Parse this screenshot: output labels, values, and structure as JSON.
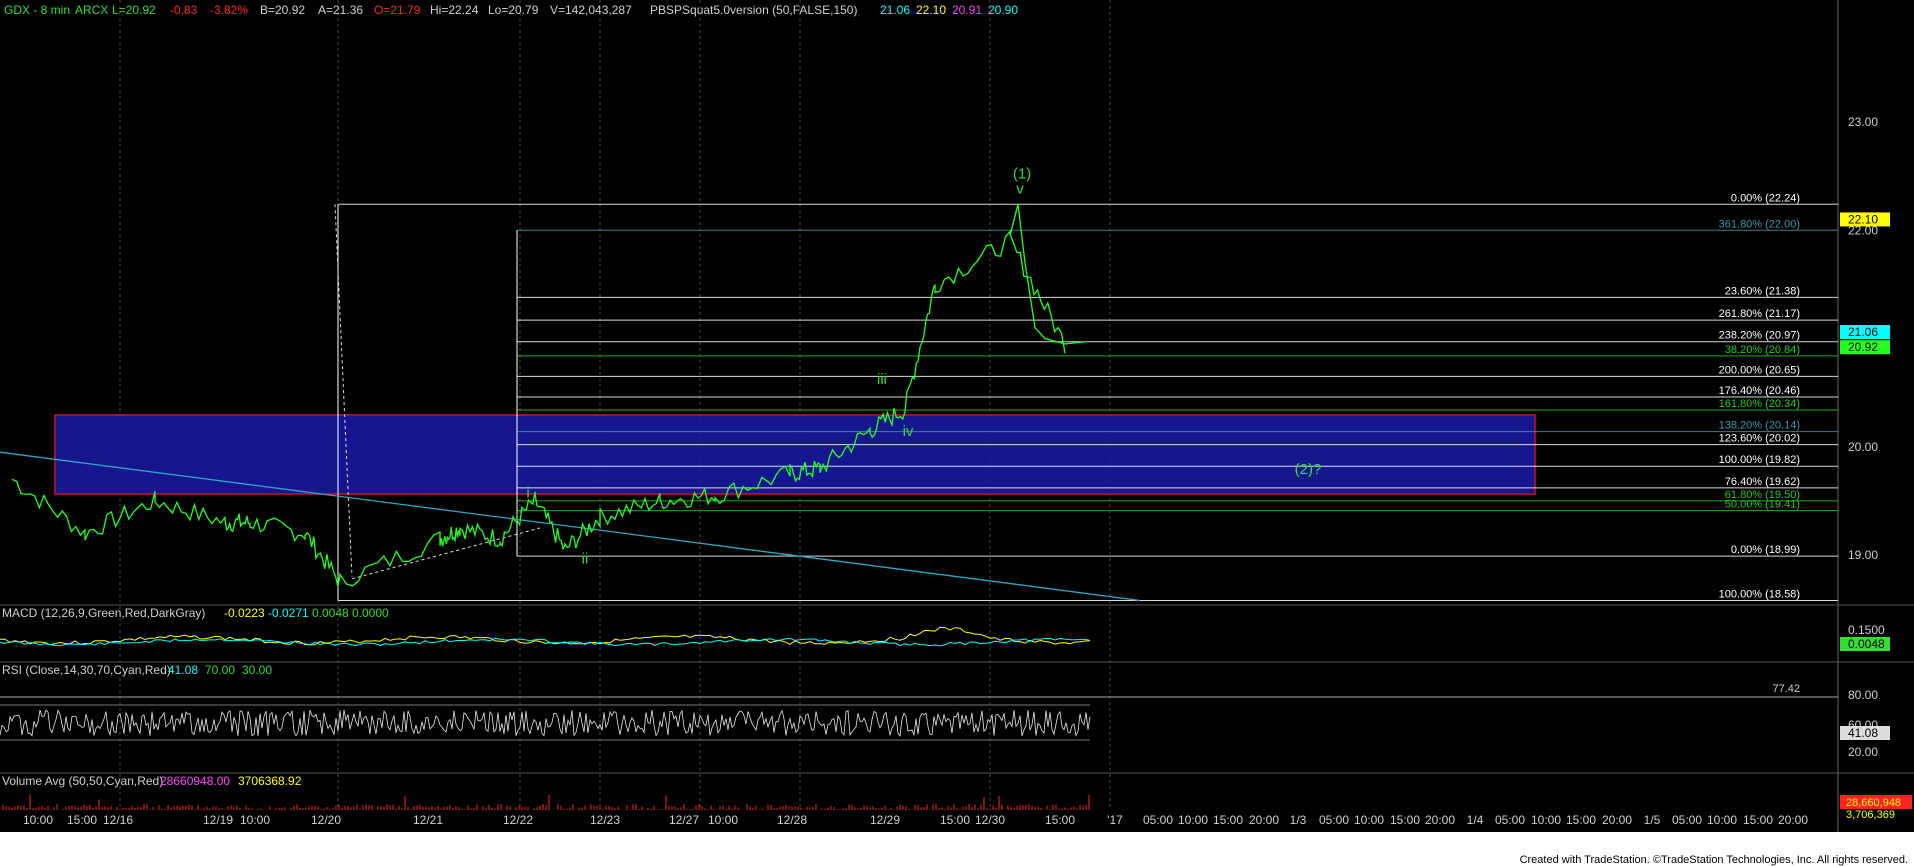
{
  "header": {
    "symbol": "GDX - 8 min",
    "exchange": "ARCX",
    "last": "L=20.92",
    "change": "-0.83",
    "pct": "-3.82%",
    "bid": "B=20.92",
    "ask": "A=21.36",
    "open": "O=21.79",
    "high": "Hi=22.24",
    "low": "Lo=20.79",
    "volume": "V=142,043,287",
    "indicator": "PBSPSquat5.0version (50,FALSE,150)",
    "ind_v1": "21.06",
    "ind_v2": "22.10",
    "ind_v3": "20.91",
    "ind_v4": "20.90"
  },
  "colors": {
    "price": "#22ff22",
    "fib_green": "#22cc22",
    "fib_white": "#ffffff",
    "fib_teal": "#3a9aa8",
    "box_fill": "#1a1aa8",
    "box_border": "#cc1133",
    "label_green": "#33dd33",
    "trend": "#2aa8c8",
    "cyan": "#00ffff",
    "yellow": "#ffff00",
    "magenta": "#ff44ff",
    "red": "#ff2222"
  },
  "price_axis": {
    "labels": [
      "23.00",
      "22.00",
      "20.00",
      "19.00"
    ],
    "tags": [
      {
        "text": "22.10",
        "bg": "#ffff00",
        "fg": "#000000"
      },
      {
        "text": "21.06",
        "bg": "#00ffff",
        "fg": "#000000"
      },
      {
        "text": "20.92",
        "bg": "#22ff22",
        "fg": "#000000"
      }
    ]
  },
  "fib_labels": [
    {
      "text": "0.00% (22.24)",
      "price": 22.24,
      "color": "white"
    },
    {
      "text": "361.80% (22.00)",
      "price": 22.0,
      "color": "teal"
    },
    {
      "text": "23.60% (21.38)",
      "price": 21.38,
      "color": "white"
    },
    {
      "text": "261.80% (21.17)",
      "price": 21.17,
      "color": "white"
    },
    {
      "text": "238.20% (20.97)",
      "price": 20.97,
      "color": "white"
    },
    {
      "text": "38.20% (20.84)",
      "price": 20.84,
      "color": "green"
    },
    {
      "text": "200.00% (20.65)",
      "price": 20.65,
      "color": "white"
    },
    {
      "text": "176.40% (20.46)",
      "price": 20.46,
      "color": "white"
    },
    {
      "text": "161.80% (20.34)",
      "price": 20.34,
      "color": "green"
    },
    {
      "text": "138.20% (20.14)",
      "price": 20.14,
      "color": "teal"
    },
    {
      "text": "123.60% (20.02)",
      "price": 20.02,
      "color": "white"
    },
    {
      "text": "100.00% (19.82)",
      "price": 19.82,
      "color": "white"
    },
    {
      "text": "76.40% (19.62)",
      "price": 19.62,
      "color": "white"
    },
    {
      "text": "61.80% (19.50)",
      "price": 19.5,
      "color": "green"
    },
    {
      "text": "50.00% (19.41)",
      "price": 19.41,
      "color": "green"
    },
    {
      "text": "0.00% (18.99)",
      "price": 18.99,
      "color": "white"
    },
    {
      "text": "100.00% (18.58)",
      "price": 18.58,
      "color": "white"
    }
  ],
  "wave_labels": [
    {
      "text": "(1)",
      "x": "12/30 07:00",
      "price": 22.48
    },
    {
      "text": "v",
      "x": "12/30 07:00",
      "price": 22.34
    },
    {
      "text": "i",
      "x": "12/22 03:30",
      "price": 19.53
    },
    {
      "text": "ii",
      "x": "12/22 11:00",
      "price": 18.92
    },
    {
      "text": "iii",
      "x": "12/29 02:00",
      "price": 20.58
    },
    {
      "text": "iv",
      "x": "12/29 05:00",
      "price": 20.1
    },
    {
      "text": "(2)?",
      "x": "1/4 02:00",
      "price": 19.75
    }
  ],
  "macd": {
    "label": "MACD (12,26,9,Green,Red,DarkGray)",
    "v1": "-0.0223",
    "v2": "-0.0271",
    "v3": "0.0048",
    "v4": "0.0000",
    "axis_labels": [
      "0.1500",
      "0.0048"
    ]
  },
  "rsi": {
    "label": "RSI (Close,14,30,70,Cyan,Red)",
    "v1": "41.08",
    "v2": "70.00",
    "v3": "30.00",
    "axis_labels": [
      "80.00",
      "60.00",
      "41.08",
      "20.00"
    ],
    "marker": "77.42"
  },
  "volume": {
    "label": "Volume Avg (50,50,Cyan,Red)",
    "v1": "28660948.00",
    "v2": "3706368.92",
    "axis_labels": [
      "28,660,948",
      "3,706,369"
    ]
  },
  "time_axis": {
    "labels": [
      "10:00",
      "15:00",
      "12/16",
      "12/19",
      "10:00",
      "12/20",
      "12/21",
      "12/22",
      "12/23",
      "12/27",
      "10:00",
      "12/28",
      "12/29",
      "15:00",
      "12/30",
      "15:00",
      "'17",
      "05:00",
      "10:00",
      "15:00",
      "20:00",
      "1/3",
      "05:00",
      "10:00",
      "15:00",
      "20:00",
      "1/4",
      "05:00",
      "10:00",
      "15:00",
      "20:00",
      "1/5",
      "05:00",
      "10:00",
      "15:00",
      "20:00"
    ]
  },
  "credit": "Created with TradeStation. ©TradeStation Technologies, Inc. All rights reserved.",
  "chart_data": {
    "type": "line",
    "title": "GDX - 8 min",
    "ylim": [
      18.45,
      23.3
    ],
    "xlabel": "",
    "ylabel": "",
    "grid": true,
    "legend": "none",
    "series": [
      {
        "name": "GDX",
        "x": [
          "12/15 10:00",
          "12/15 15:00",
          "12/16 10:00",
          "12/16 15:00",
          "12/19 10:00",
          "12/19 15:00",
          "12/20 10:00",
          "12/20 15:00",
          "12/21 10:00",
          "12/21 15:00",
          "12/22 10:00",
          "12/22 15:00",
          "12/23 10:00",
          "12/23 15:00",
          "12/27 10:00",
          "12/27 15:00",
          "12/28 10:00",
          "12/28 15:00",
          "12/29 10:00",
          "12/29 15:00",
          "12/30 10:00",
          "12/30 15:00"
        ],
        "values": [
          19.7,
          19.2,
          19.5,
          19.3,
          19.3,
          19.2,
          18.75,
          19.15,
          19.25,
          19.15,
          19.5,
          19.05,
          19.35,
          19.5,
          19.55,
          19.75,
          19.8,
          20.15,
          20.35,
          21.5,
          21.9,
          20.95
        ]
      }
    ]
  }
}
